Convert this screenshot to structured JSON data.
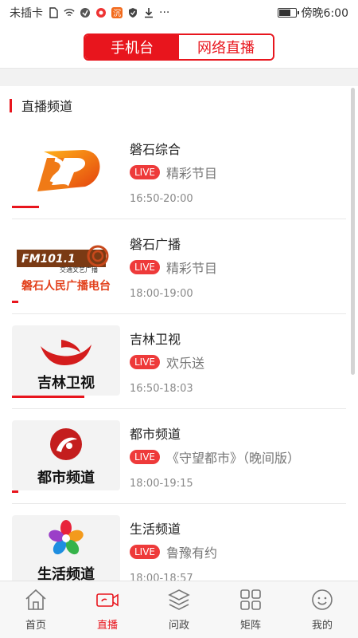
{
  "status_bar": {
    "carrier": "未插卡",
    "clock": "傍晚6:00",
    "more": "···",
    "battery_level": 0.75
  },
  "header": {
    "tabs": [
      {
        "label": "手机台",
        "active": true
      },
      {
        "label": "网络直播",
        "active": false
      }
    ]
  },
  "section": {
    "title": "直播频道"
  },
  "channels": [
    {
      "name": "磐石综合",
      "live": "LIVE",
      "program": "精彩节目",
      "time": "16:50-20:00",
      "progress": 0.25
    },
    {
      "name": "磐石广播",
      "live": "LIVE",
      "program": "精彩节目",
      "time": "18:00-19:00",
      "progress": 0.06,
      "logo_top": "FM101.1",
      "logo_sub": "交通文艺广播",
      "logo_bottom": "磐石人民广播电台"
    },
    {
      "name": "吉林卫视",
      "live": "LIVE",
      "program": "欢乐送",
      "time": "16:50-18:03",
      "progress": 0.67,
      "logo_text": "吉林卫视"
    },
    {
      "name": "都市频道",
      "live": "LIVE",
      "program": "《守望都市》（晚间版）",
      "time": "18:00-19:15",
      "progress": 0.06,
      "logo_text": "都市频道"
    },
    {
      "name": "生活频道",
      "live": "LIVE",
      "program": "鲁豫有约",
      "time": "18:00-18:57",
      "progress": 0.0,
      "logo_text": "生活频道"
    }
  ],
  "tabbar": [
    {
      "label": "首页",
      "icon": "home-icon",
      "active": false
    },
    {
      "label": "直播",
      "icon": "video-camera-icon",
      "active": true
    },
    {
      "label": "问政",
      "icon": "layers-icon",
      "active": false
    },
    {
      "label": "矩阵",
      "icon": "grid-icon",
      "active": false
    },
    {
      "label": "我的",
      "icon": "smiley-icon",
      "active": false
    }
  ],
  "colors": {
    "accent": "#e8151d",
    "live_badge": "#ee3a3a"
  }
}
